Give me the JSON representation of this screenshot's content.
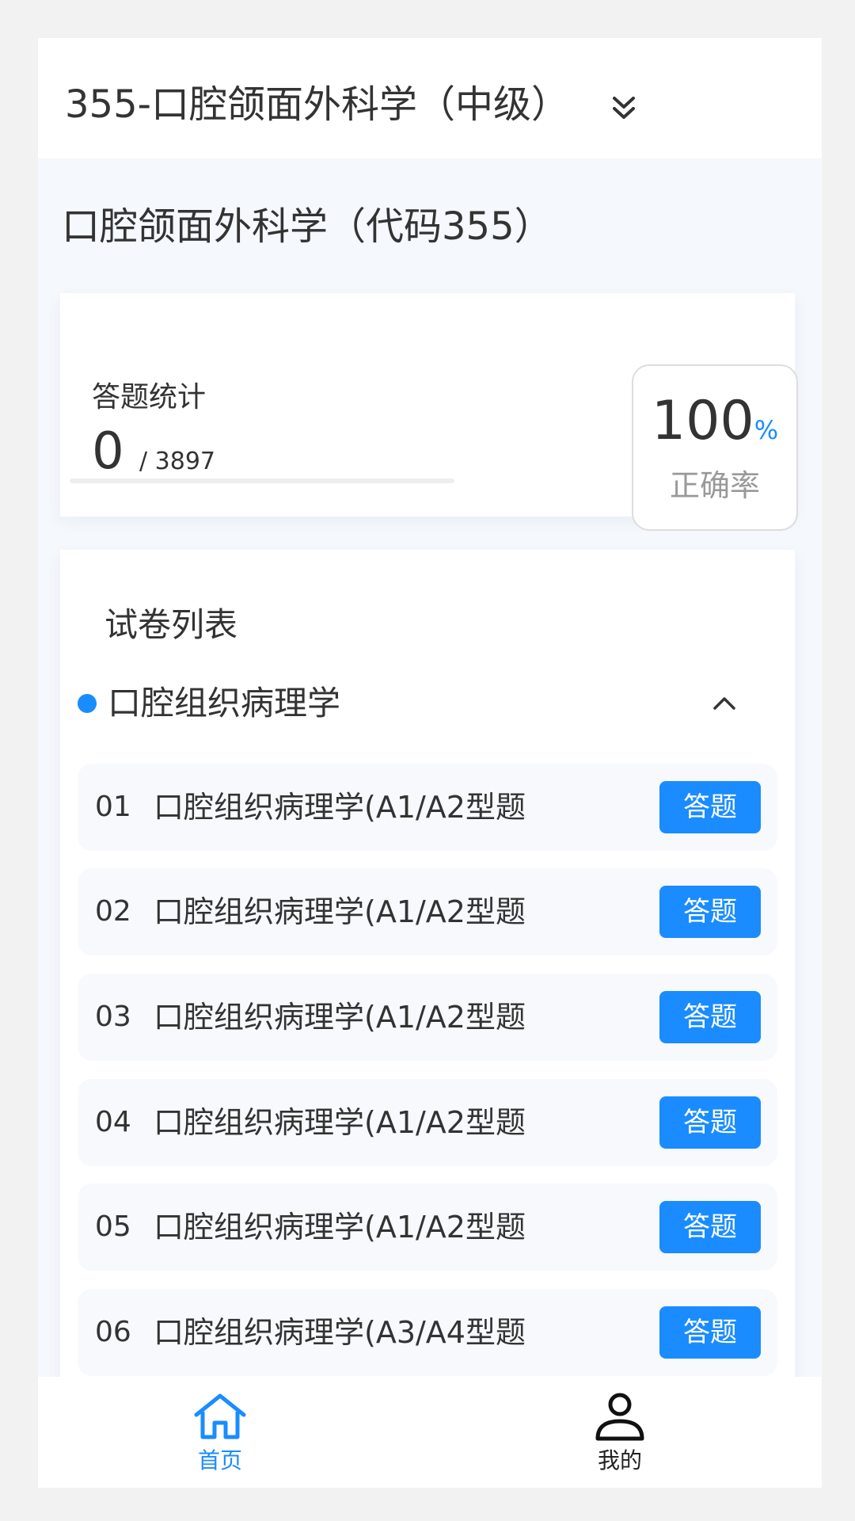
{
  "header": {
    "exam_title": "355-口腔颌面外科学（中级）"
  },
  "subject": {
    "title": "口腔颌面外科学（代码355）"
  },
  "stats": {
    "label": "答题统计",
    "answered": "0",
    "total": "/ 3897",
    "progress_fraction": 0,
    "accuracy_value": "100",
    "accuracy_unit": "%",
    "accuracy_label": "正确率"
  },
  "paper_list": {
    "title": "试卷列表",
    "section": {
      "name": "口腔组织病理学",
      "expanded": true
    },
    "papers": [
      {
        "num": "01",
        "name": "口腔组织病理学(A1/A2型题",
        "button": "答题"
      },
      {
        "num": "02",
        "name": "口腔组织病理学(A1/A2型题",
        "button": "答题"
      },
      {
        "num": "03",
        "name": "口腔组织病理学(A1/A2型题",
        "button": "答题"
      },
      {
        "num": "04",
        "name": "口腔组织病理学(A1/A2型题",
        "button": "答题"
      },
      {
        "num": "05",
        "name": "口腔组织病理学(A1/A2型题",
        "button": "答题"
      },
      {
        "num": "06",
        "name": "口腔组织病理学(A3/A4型题",
        "button": "答题"
      }
    ]
  },
  "tabbar": {
    "items": [
      {
        "label": "首页",
        "icon": "home-icon",
        "active": true
      },
      {
        "label": "我的",
        "icon": "user-icon",
        "active": false
      }
    ]
  },
  "colors": {
    "accent": "#1a8cff",
    "text": "#333333",
    "muted": "#999999",
    "page_bg": "#f5f8fc"
  }
}
